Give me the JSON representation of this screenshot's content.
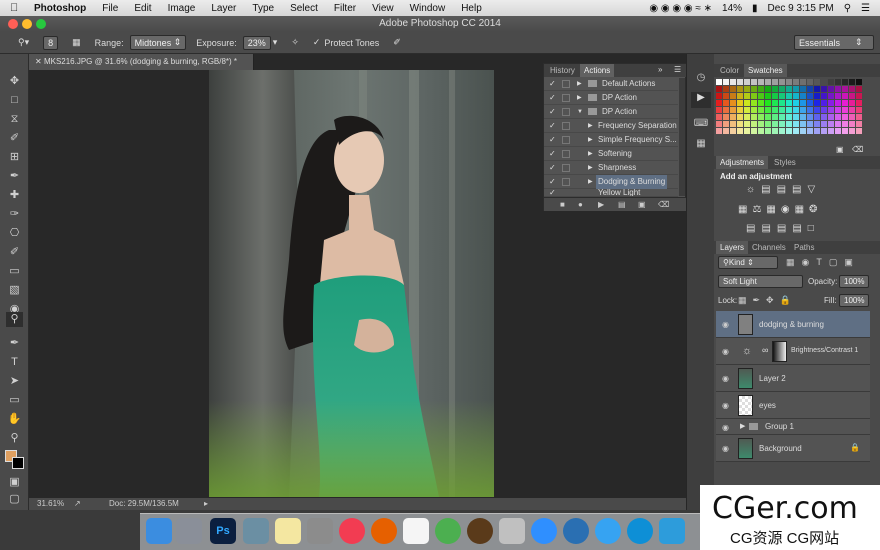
{
  "menubar": {
    "app": "Photoshop",
    "items": [
      "File",
      "Edit",
      "Image",
      "Layer",
      "Type",
      "Select",
      "Filter",
      "View",
      "Window",
      "Help"
    ],
    "battery": "14%",
    "clock": "Dec 9  3:15 PM"
  },
  "window": {
    "title": "Adobe Photoshop CC 2014"
  },
  "options": {
    "brush_size": "8",
    "range_label": "Range:",
    "range_value": "Midtones",
    "exposure_label": "Exposure:",
    "exposure_value": "23%",
    "protect_label": "Protect Tones",
    "workspace": "Essentials"
  },
  "document": {
    "tab": "MKS216.JPG @ 31.6% (dodging & burning, RGB/8*) *",
    "zoom": "31.61%",
    "doc_size": "Doc: 29.5M/136.5M"
  },
  "actions_panel": {
    "tabs": [
      "History",
      "Actions"
    ],
    "rows": [
      "Default Actions",
      "DP Action",
      "DP Action",
      "Frequency Separation",
      "Simple Frequency S...",
      "Softening",
      "Sharpness",
      "Dodging & Burning",
      "Yellow Light"
    ]
  },
  "color_panel": {
    "tabs": [
      "Color",
      "Swatches"
    ]
  },
  "adjustments_panel": {
    "tabs": [
      "Adjustments",
      "Styles"
    ],
    "heading": "Add an adjustment"
  },
  "layers_panel": {
    "tabs": [
      "Layers",
      "Channels",
      "Paths"
    ],
    "filter": "Kind",
    "blend_mode": "Soft Light",
    "opacity_label": "Opacity:",
    "opacity_value": "100%",
    "lock_label": "Lock:",
    "fill_label": "Fill:",
    "fill_value": "100%",
    "layers": [
      "dodging & burning",
      "Brightness/Contrast 1",
      "Layer 2",
      "eyes",
      "Group 1",
      "Background"
    ]
  },
  "watermark": {
    "line1": "CGer.com",
    "line2": "CG资源 CG网站"
  },
  "colors": {
    "accent_selected": "#5f6f84"
  }
}
